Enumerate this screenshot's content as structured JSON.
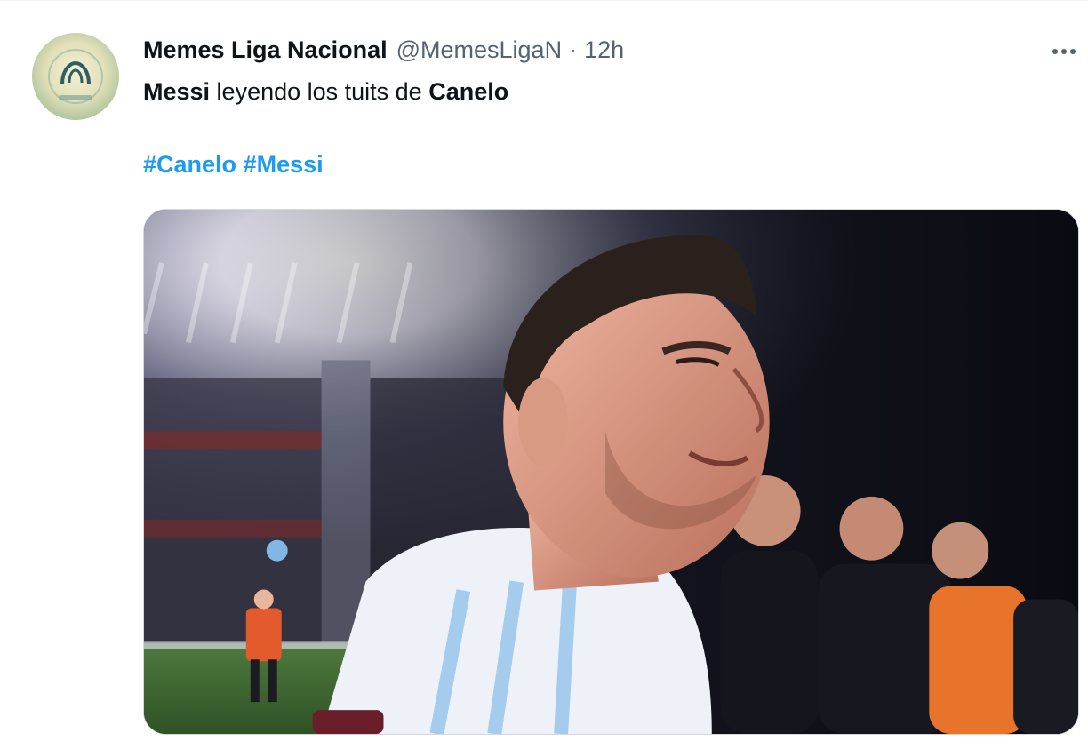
{
  "author": {
    "display_name": "Memes Liga Nacional",
    "handle": "@MemesLigaN",
    "separator": "·",
    "time": "12h",
    "avatar_icon": "memes-liga-logo"
  },
  "tweet": {
    "text_parts": [
      "Messi",
      " leyendo los tuits de ",
      "Canelo"
    ],
    "hashtags": [
      "#Canelo",
      "#Messi"
    ]
  },
  "media": {
    "description_icon": "tearful-player-photo"
  },
  "menu": {
    "more_icon": "more-horizontal-icon"
  },
  "colors": {
    "link": "#1d9bf0",
    "secondary_text": "#536471",
    "border": "#cfd9de"
  }
}
